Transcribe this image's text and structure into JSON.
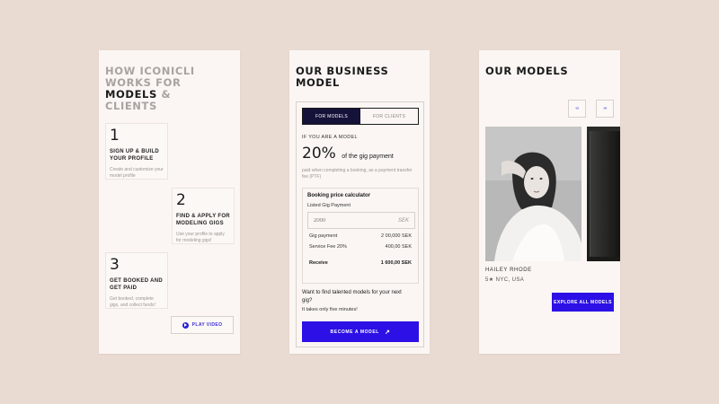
{
  "how_it_works": {
    "title_line1": "HOW ICONICLI",
    "title_line2": "WORKS FOR",
    "title_line3_strong": "MODELS",
    "title_line3_rest": " &",
    "title_line4": "CLIENTS",
    "steps": [
      {
        "num": "1",
        "title": "SIGN UP & BUILD YOUR PROFILE",
        "desc": "Create and customize your model profile"
      },
      {
        "num": "2",
        "title": "FIND & APPLY FOR MODELING GIGS",
        "desc": "Use your profile to apply for modeling gigs!"
      },
      {
        "num": "3",
        "title": "GET BOOKED AND GET PAID",
        "desc": "Get booked, complete gigs, and collect funds!"
      }
    ],
    "play_video_label": "PLAY VIDEO",
    "play_icon": "play-icon"
  },
  "business_model": {
    "title_line1": "OUR BUSINESS",
    "title_line2": "MODEL",
    "tabs": [
      {
        "label": "FOR MODELS",
        "active": true
      },
      {
        "label": "FOR CLIENTS",
        "active": false
      }
    ],
    "if_model_label": "IF YOU ARE A MODEL",
    "percent": "20%",
    "percent_suffix": "of the gig payment",
    "percent_desc": "paid when completing a booking, as a payment transfer fee (PTF)",
    "calculator": {
      "title": "Booking price calculator",
      "field_label": "Listed Gig Payment",
      "input_placeholder": "2000",
      "currency": "SEK",
      "rows": [
        {
          "label": "Gig payment",
          "value": "2 00,000 SEK"
        },
        {
          "label": "Service Fee 20%",
          "value": "400,00 SEK"
        }
      ],
      "receive_label": "Receive",
      "receive_value": "1 600,00 SEK"
    },
    "find_text": "Want to find talented models for your next gig?",
    "takes_five": "It takes only five minutes!",
    "become_model_label": "BECOME A MODEL",
    "arrow_icon": "arrow-up-right-icon"
  },
  "our_models": {
    "title": "OUR MODELS",
    "prev_label": "‹‹‹",
    "next_label": "›››",
    "model_name": "HAILEY RHODE",
    "model_meta": "5★ NYC, USA",
    "explore_label": "EXPLORE ALL MODELS"
  }
}
